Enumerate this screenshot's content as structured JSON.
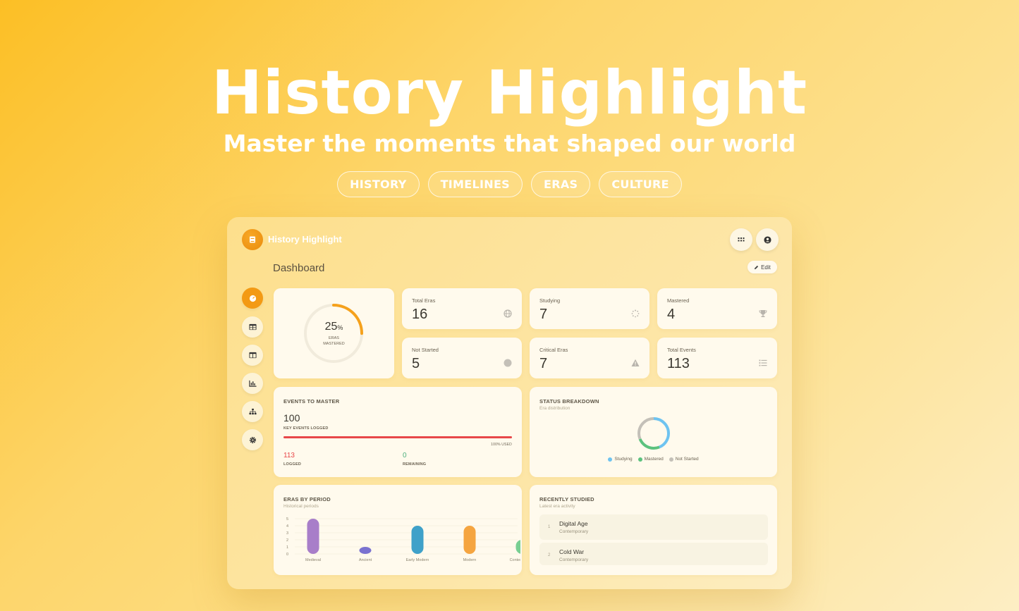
{
  "hero": {
    "title": "History Highlight",
    "subtitle": "Master the moments that shaped our world",
    "tags": [
      "HISTORY",
      "TIMELINES",
      "ERAS",
      "CULTURE"
    ]
  },
  "app": {
    "name": "History Highlight",
    "page_title": "Dashboard",
    "edit_label": "Edit",
    "top_icons": [
      "apps-grid-icon",
      "user-account-icon"
    ],
    "nav_icons": [
      "dashboard-gauge-icon",
      "table-icon",
      "columns-icon",
      "chart-icon",
      "hierarchy-icon",
      "settings-gear-icon"
    ]
  },
  "progress": {
    "percent": 25,
    "percent_label": "25",
    "percent_unit": "%",
    "label_line1": "ERAS",
    "label_line2": "MASTERED",
    "accent": "#f5a11c"
  },
  "stats": [
    {
      "label": "Total Eras",
      "value": "16",
      "icon": "globe-icon"
    },
    {
      "label": "Studying",
      "value": "7",
      "icon": "spinner-icon"
    },
    {
      "label": "Mastered",
      "value": "4",
      "icon": "trophy-icon"
    },
    {
      "label": "Not Started",
      "value": "5",
      "icon": "circle-icon"
    },
    {
      "label": "Critical Eras",
      "value": "7",
      "icon": "warning-icon"
    },
    {
      "label": "Total Events",
      "value": "113",
      "icon": "list-icon"
    }
  ],
  "events": {
    "title": "EVENTS TO MASTER",
    "value": "100",
    "value_caption": "KEY EVENTS LOGGED",
    "bar_fill": 1.0,
    "bar_caption": "100% USED",
    "logged_value": "113",
    "logged_caption": "LOGGED",
    "remaining_value": "0",
    "remaining_caption": "REMAINING",
    "bar_color": "#e8474a",
    "remaining_color": "#4caf7d"
  },
  "status": {
    "title": "STATUS BREAKDOWN",
    "subtitle": "Era distribution",
    "legend": [
      {
        "label": "Studying",
        "color": "#6ec3f0"
      },
      {
        "label": "Mastered",
        "color": "#5cc27e"
      },
      {
        "label": "Not Started",
        "color": "#c4c0b8"
      }
    ],
    "chart_data": {
      "type": "pie",
      "categories": [
        "Studying",
        "Mastered",
        "Not Started"
      ],
      "values": [
        7,
        4,
        5
      ]
    }
  },
  "eras_by_period": {
    "title": "ERAS BY PERIOD",
    "subtitle": "Historical periods",
    "chart_data": {
      "type": "bar",
      "categories": [
        "Medieval",
        "Ancient",
        "Early Modern",
        "Modern",
        "Contemporary"
      ],
      "values": [
        5,
        1,
        4,
        4,
        2
      ],
      "colors": [
        "#a87ec9",
        "#7a72d0",
        "#3fa1c9",
        "#f5a540",
        "#78cf92"
      ],
      "ylim": [
        0,
        5
      ],
      "yticks": [
        "0",
        "1",
        "2",
        "3",
        "4",
        "5"
      ]
    }
  },
  "recent": {
    "title": "RECENTLY STUDIED",
    "subtitle": "Latest era activity",
    "items": [
      {
        "num": "1",
        "title": "Digital Age",
        "sub": "Contemporary"
      },
      {
        "num": "2",
        "title": "Cold War",
        "sub": "Contemporary"
      }
    ]
  }
}
